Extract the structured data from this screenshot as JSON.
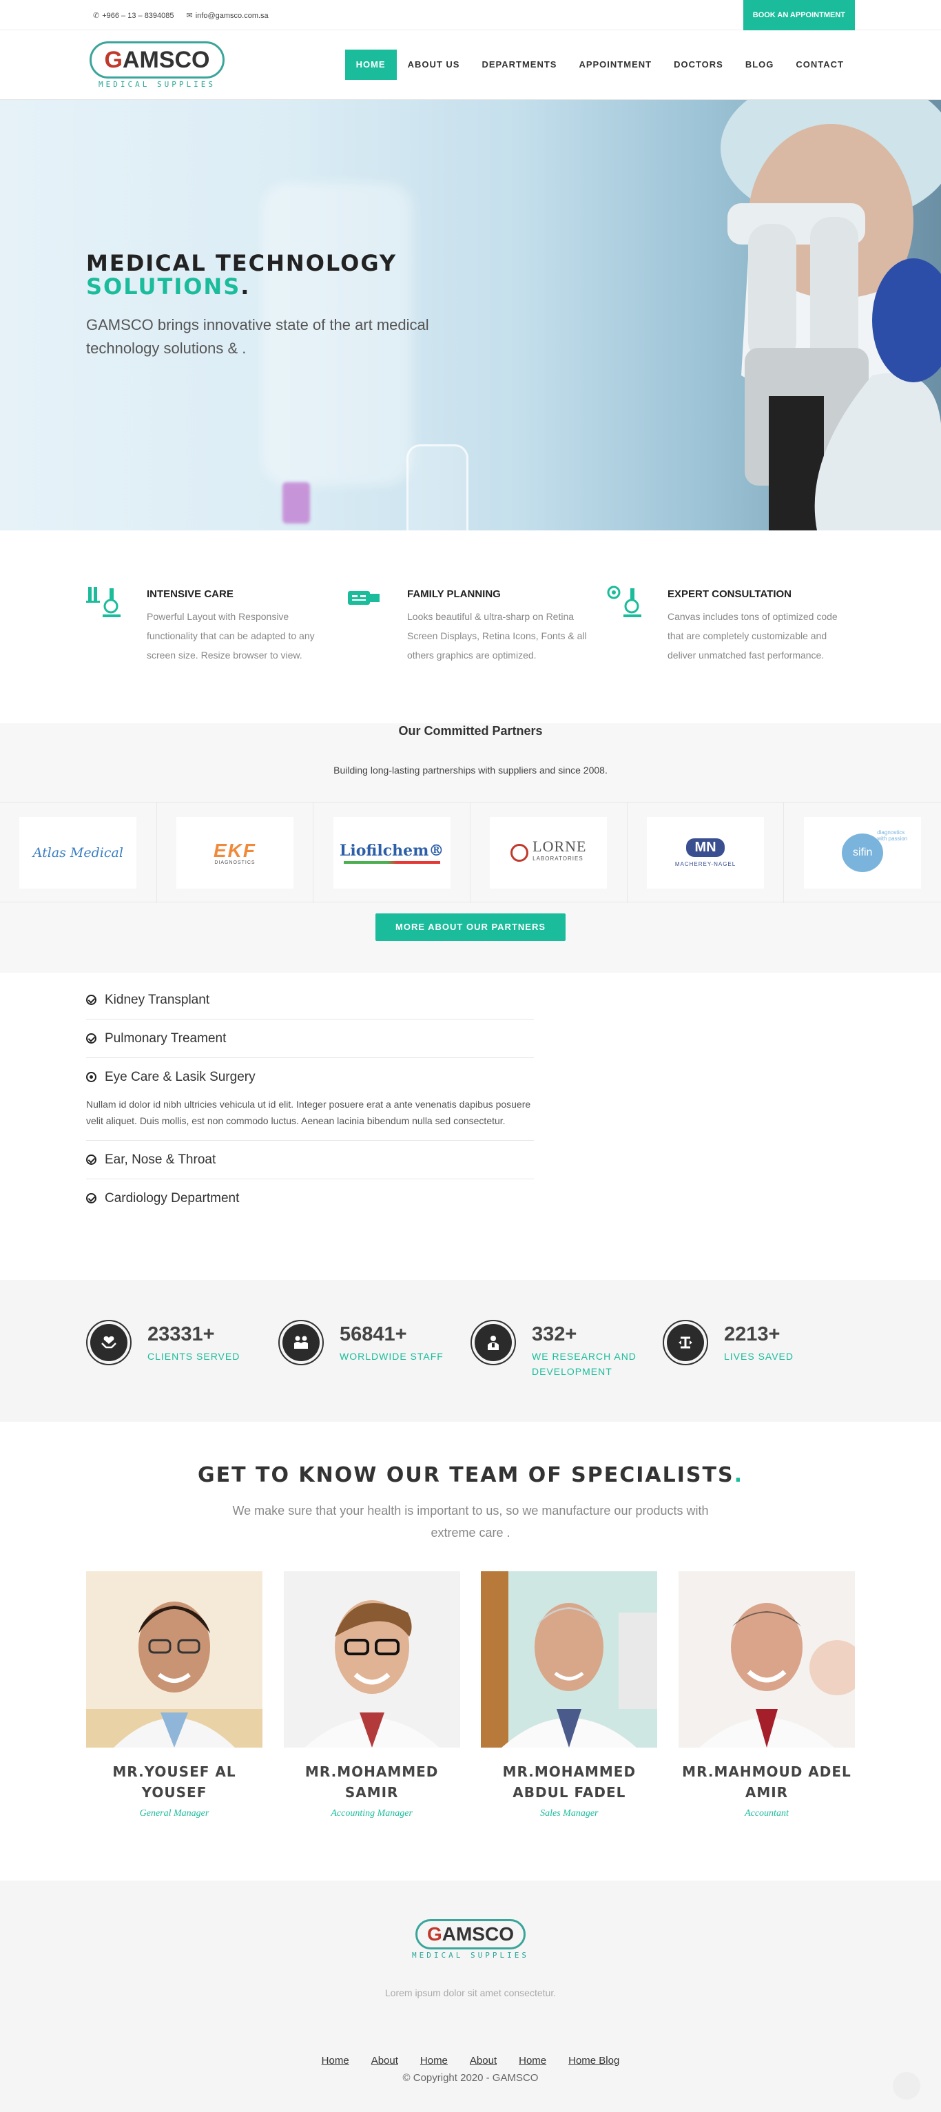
{
  "topbar": {
    "phone": "+966 – 13 – 8394085",
    "email": "info@gamsco.com.sa",
    "appointment_button": "BOOK AN APPOINTMENT"
  },
  "brand": {
    "name_prefix": "",
    "name_g": "G",
    "name_rest": "AMSCO",
    "tagline": "MEDICAL SUPPLIES"
  },
  "nav": [
    "HOME",
    "ABOUT US",
    "DEPARTMENTS",
    "APPOINTMENT",
    "DOCTORS",
    "BLOG",
    "CONTACT"
  ],
  "hero": {
    "title_line1": "MEDICAL TECHNOLOGY",
    "title_accent": "SOLUTIONS",
    "title_period": ".",
    "text": "GAMSCO brings innovative state of the art medical technology solutions & ."
  },
  "features": [
    {
      "title": "INTENSIVE CARE",
      "text": "Powerful Layout with Responsive functionality that can be adapted to any screen size. Resize browser to view.",
      "icon": "intensive-care-icon"
    },
    {
      "title": "FAMILY PLANNING",
      "text": "Looks beautiful & ultra-sharp on Retina Screen Displays, Retina Icons, Fonts & all others graphics are optimized.",
      "icon": "family-planning-icon"
    },
    {
      "title": "EXPERT CONSULTATION",
      "text": "Canvas includes tons of optimized code that are completely customizable and deliver unmatched fast performance.",
      "icon": "expert-consultation-icon"
    }
  ],
  "partners": {
    "title": "Our Committed Partners",
    "subtitle": "Building long-lasting partnerships with suppliers and since 2008.",
    "logos": [
      "Atlas Medical",
      "EKF",
      "Liofilchem®",
      "LORNE",
      "MN",
      "sifin"
    ],
    "ekf_sub": "DIAGNOSTICS",
    "lorne_sub": "LABORATORIES",
    "mn_sub": "MACHEREY-NAGEL",
    "sifin_sub": "diagnostics with passion",
    "button": "MORE ABOUT OUR PARTNERS"
  },
  "accordion": [
    {
      "title": "Kidney Transplant",
      "open": false
    },
    {
      "title": "Pulmonary Treament",
      "open": false
    },
    {
      "title": "Eye Care & Lasik Surgery",
      "open": true,
      "body": "Nullam id dolor id nibh ultricies vehicula ut id elit. Integer posuere erat a ante venenatis dapibus posuere velit aliquet. Duis mollis, est non commodo luctus. Aenean lacinia bibendum nulla sed consectetur."
    },
    {
      "title": "Ear, Nose & Throat",
      "open": false
    },
    {
      "title": "Cardiology Department",
      "open": false
    }
  ],
  "stats": [
    {
      "value": "23331+",
      "label": "CLIENTS SERVED",
      "icon": "hands-heart-icon"
    },
    {
      "value": "56841+",
      "label": "WORLDWIDE STAFF",
      "icon": "staff-icon"
    },
    {
      "value": "332+",
      "label": "WE RESEARCH AND DEVELOPMENT",
      "icon": "research-icon"
    },
    {
      "value": "2213+",
      "label": "LIVES SAVED",
      "icon": "lives-saved-icon"
    }
  ],
  "team": {
    "title": "GET TO KNOW OUR TEAM OF SPECIALISTS",
    "title_dot": ".",
    "lead": "We make sure that your health is important to us, so we manufacture our products with extreme care .",
    "members": [
      {
        "name": "MR.YOUSEF AL YOUSEF",
        "role": "General Manager"
      },
      {
        "name": "MR.MOHAMMED SAMIR",
        "role": "Accounting Manager"
      },
      {
        "name": "MR.MOHAMMED ABDUL FADEL",
        "role": "Sales Manager"
      },
      {
        "name": "MR.MAHMOUD ADEL AMIR",
        "role": "Accountant"
      }
    ]
  },
  "footer": {
    "tagline": "Lorem ipsum dolor sit amet consectetur.",
    "links": [
      "Home",
      "About",
      "Home",
      "About",
      "Home",
      "Home Blog"
    ],
    "copyright": "© Copyright 2020 - GAMSCO"
  },
  "colors": {
    "accent": "#1abc9c",
    "dark": "#222222"
  }
}
